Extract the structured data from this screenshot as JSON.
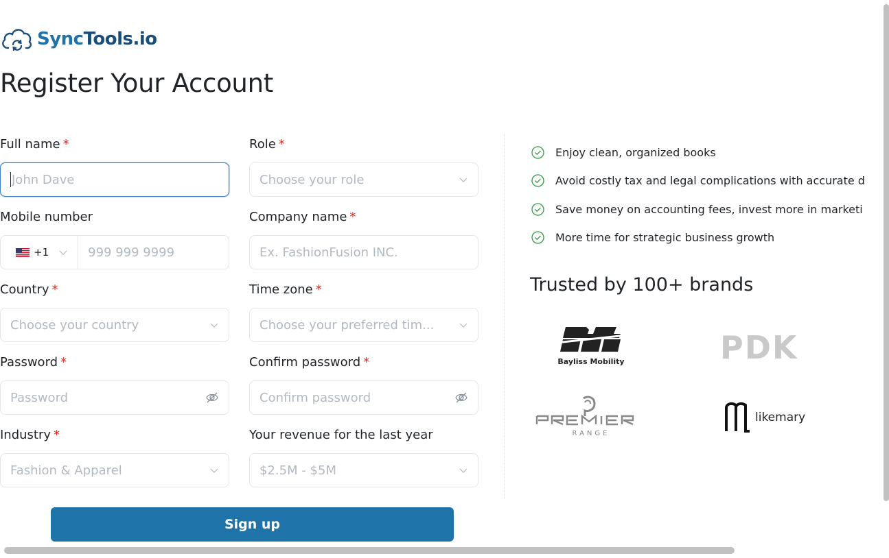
{
  "brand": {
    "name_part1": "Sync",
    "name_part2": "Tools.io"
  },
  "page_title": "Register Your Account",
  "form": {
    "full_name": {
      "label": "Full name",
      "required": "*",
      "placeholder": "John Dave"
    },
    "role": {
      "label": "Role",
      "required": "*",
      "placeholder": "Choose your role"
    },
    "mobile": {
      "label": "Mobile number",
      "country_code": "+1",
      "placeholder": "999 999 9999"
    },
    "company": {
      "label": "Company name",
      "required": "*",
      "placeholder": "Ex. FashionFusion INC."
    },
    "country": {
      "label": "Country",
      "required": "*",
      "placeholder": "Choose your country"
    },
    "timezone": {
      "label": "Time zone",
      "required": "*",
      "placeholder": "Choose your preferred tim..."
    },
    "password": {
      "label": "Password",
      "required": "*",
      "placeholder": "Password"
    },
    "confirm_password": {
      "label": "Confirm password",
      "required": "*",
      "placeholder": "Confirm password"
    },
    "industry": {
      "label": "Industry",
      "required": "*",
      "value": "Fashion & Apparel"
    },
    "revenue": {
      "label": "Your revenue for the last year",
      "value": "$2.5M - $5M"
    },
    "submit_label": "Sign up"
  },
  "benefits": [
    "Enjoy clean, organized books",
    "Avoid costly tax and legal complications with accurate d",
    "Save money on accounting fees, invest more in marketi",
    "More time for strategic business growth"
  ],
  "trusted_heading": "Trusted by 100+ brands",
  "brands": {
    "bayliss": "Bayliss Mobility",
    "pdk": "PDK",
    "premier_range": "RANGE",
    "likemary": "likemary"
  },
  "colors": {
    "accent": "#1e73a8",
    "required": "#d92d20",
    "check": "#2e9e3f"
  }
}
